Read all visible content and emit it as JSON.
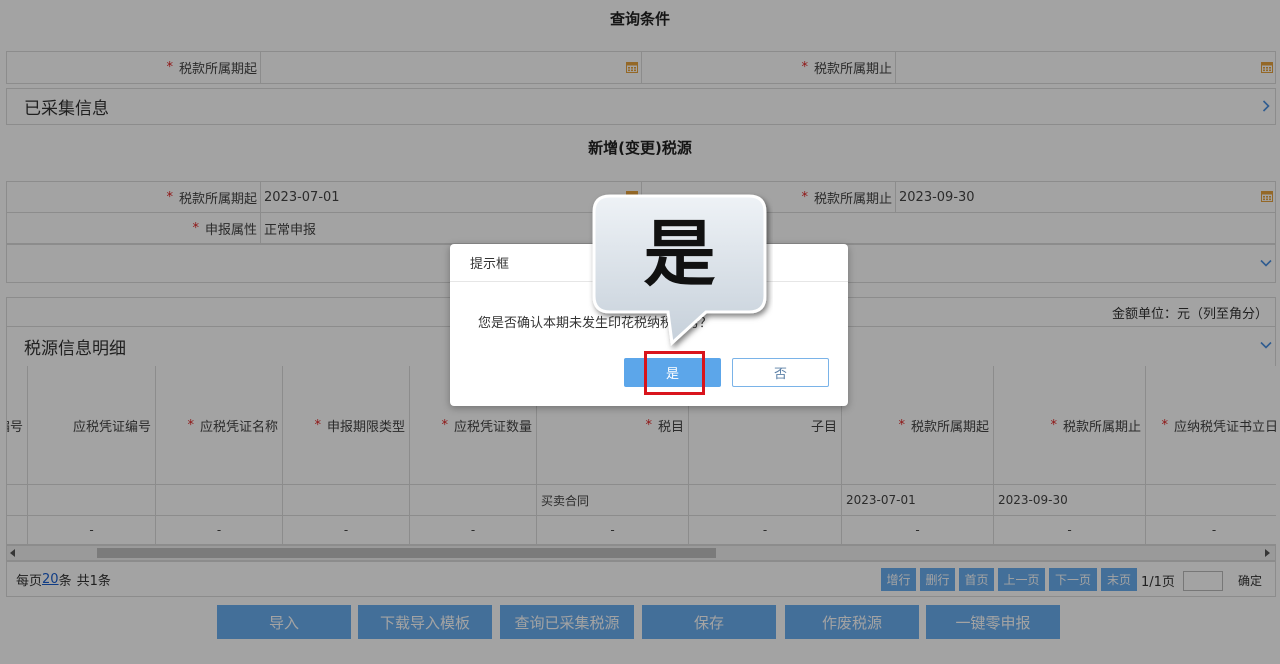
{
  "required_mark": "*",
  "query": {
    "title": "查询条件",
    "start_label": "税款所属期起",
    "start_value": "",
    "end_label": "税款所属期止",
    "end_value": ""
  },
  "collected": {
    "title": "已采集信息"
  },
  "new_source": {
    "title": "新增(变更)税源",
    "start_label": "税款所属期起",
    "start_value": "2023-07-01",
    "end_label": "税款所属期止",
    "end_value": "2023-09-30",
    "attr_label": "申报属性",
    "attr_value": "正常申报",
    "amount_unit": "金额单位：元（列至角分）"
  },
  "detail": {
    "title": "税源信息明细"
  },
  "table": {
    "columns": [
      {
        "label": "编号",
        "required": false
      },
      {
        "label": "应税凭证编号",
        "required": false
      },
      {
        "label": "应税凭证名称",
        "required": true
      },
      {
        "label": "申报期限类型",
        "required": true
      },
      {
        "label": "应税凭证数量",
        "required": true
      },
      {
        "label": "税目",
        "required": true
      },
      {
        "label": "子目",
        "required": false
      },
      {
        "label": "税款所属期起",
        "required": true
      },
      {
        "label": "税款所属期止",
        "required": true
      },
      {
        "label": "应纳税凭证书立日",
        "required": true
      }
    ],
    "rows": [
      [
        "",
        "",
        "",
        "",
        "",
        "买卖合同",
        "",
        "2023-07-01",
        "2023-09-30",
        ""
      ],
      [
        "",
        "-",
        "-",
        "-",
        "-",
        "-",
        "-",
        "-",
        "-",
        "-"
      ]
    ]
  },
  "pagination": {
    "per_page_prefix": "每页",
    "per_page": "20",
    "per_page_suffix": "条",
    "total": "共1条",
    "buttons": [
      "增行",
      "删行",
      "首页",
      "上一页",
      "下一页",
      "末页"
    ],
    "page_info": "1/1页",
    "goto_value": "",
    "confirm_label": "确定"
  },
  "actions": [
    "导入",
    "下载导入模板",
    "查询已采集税源",
    "保存",
    "作废税源",
    "一键零申报"
  ],
  "dialog": {
    "title": "提示框",
    "message": "您是否确认本期未发生印花税纳税义务？",
    "confirm_label": "是",
    "cancel_label": "否"
  },
  "callout": {
    "text": "是"
  },
  "icons": {
    "calendar": "calendar-icon",
    "chevron_right": "chevron-right-icon",
    "chevron_down": "chevron-down-icon",
    "scroll_left": "arrow-left-icon",
    "scroll_right": "arrow-right-icon"
  },
  "colors": {
    "primary_button": "#6aaef0",
    "dialog_confirm": "#5ca6ea",
    "required_mark": "#e02020",
    "highlight_box": "#d9141c",
    "link": "#1a5fd0",
    "calendar": "#e8a33d",
    "chevron": "#4a90e2"
  }
}
